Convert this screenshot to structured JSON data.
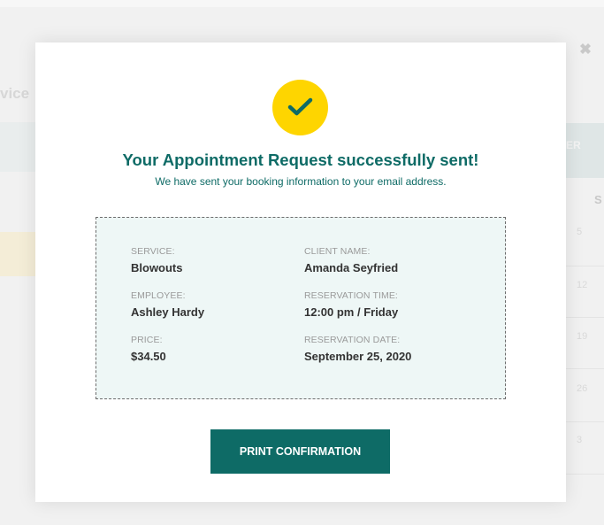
{
  "background": {
    "title_fragment": "vice",
    "header_fragment": "ER",
    "column_letter": "S",
    "numbers": [
      "5",
      "12",
      "19",
      "26",
      "3"
    ]
  },
  "modal": {
    "headline": "Your Appointment Request successfully sent!",
    "subline": "We have sent your booking information to your email address.",
    "icons": {
      "success": "check-icon",
      "close": "close-icon"
    },
    "colors": {
      "accent": "#0e6b66",
      "success_badge": "#fed500",
      "box_bg": "#eef7f6"
    },
    "details": {
      "service": {
        "label": "SERVICE:",
        "value": "Blowouts"
      },
      "employee": {
        "label": "EMPLOYEE:",
        "value": "Ashley Hardy"
      },
      "price": {
        "label": "PRICE:",
        "value": "$34.50"
      },
      "client_name": {
        "label": "CLIENT NAME:",
        "value": "Amanda Seyfried"
      },
      "reservation_time": {
        "label": "RESERVATION TIME:",
        "value": "12:00 pm / Friday"
      },
      "reservation_date": {
        "label": "RESERVATION DATE:",
        "value": "September 25, 2020"
      }
    },
    "print_button": "PRINT CONFIRMATION"
  }
}
